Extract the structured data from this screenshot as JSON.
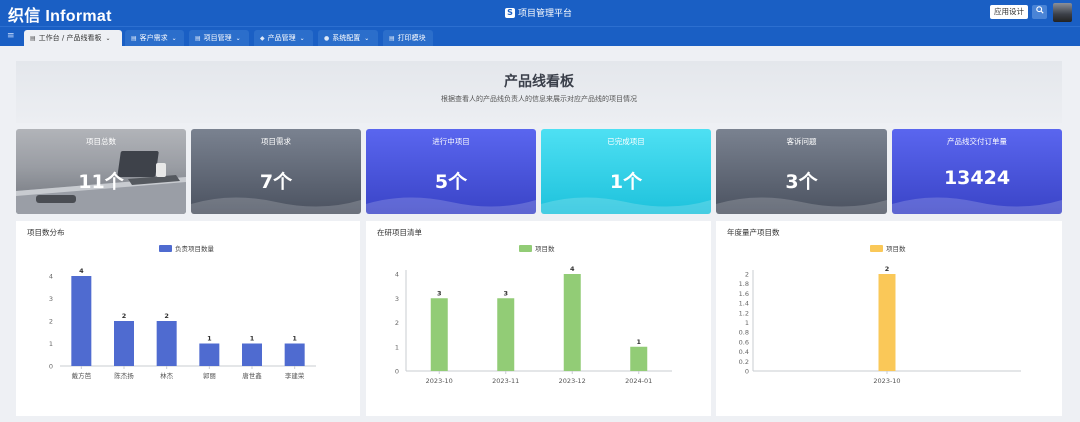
{
  "header": {
    "logo": "织信 Informat",
    "app_title": "项目管理平台",
    "app_icon_letter": "S",
    "app_design_label": "应用设计",
    "search_icon": "search-icon"
  },
  "nav": {
    "tabs": [
      {
        "label": "工作台 / 产品线看板",
        "icon": "workbench-icon",
        "active": true,
        "has_dropdown": true
      },
      {
        "label": "客户需求",
        "icon": "list-icon",
        "has_dropdown": true
      },
      {
        "label": "项目管理",
        "icon": "list-icon",
        "has_dropdown": true
      },
      {
        "label": "产品管理",
        "icon": "diamond-icon",
        "has_dropdown": true
      },
      {
        "label": "系统配置",
        "icon": "person-icon",
        "has_dropdown": true
      },
      {
        "label": "打印模块",
        "icon": "list-icon",
        "has_dropdown": false
      }
    ]
  },
  "banner": {
    "title": "产品线看板",
    "subtitle": "根据查看人的产品线负责人的信息来展示对应产品线的项目情况"
  },
  "cards": [
    {
      "label": "项目总数",
      "value": "11个",
      "style": "photo"
    },
    {
      "label": "项目需求",
      "value": "7个",
      "colors": [
        "#7a8290",
        "#4b5260"
      ]
    },
    {
      "label": "进行中项目",
      "value": "5个",
      "colors": [
        "#5a66ef",
        "#3a44c7"
      ]
    },
    {
      "label": "已完成项目",
      "value": "1个",
      "colors": [
        "#4ee0f3",
        "#1ec2dc"
      ]
    },
    {
      "label": "客诉问题",
      "value": "3个",
      "colors": [
        "#7a8290",
        "#4b5260"
      ]
    },
    {
      "label": "产品线交付订单量",
      "value": "13424",
      "colors": [
        "#5a66ef",
        "#3a44c7"
      ]
    }
  ],
  "panels": {
    "distribution": {
      "title": "项目数分布",
      "legend": "负责项目数量"
    },
    "in_progress": {
      "title": "在研项目清单",
      "legend": "项目数"
    },
    "annual": {
      "title": "年度量产项目数",
      "legend": "项目数"
    }
  },
  "chart_data": [
    {
      "type": "bar",
      "title": "项目数分布",
      "categories": [
        "戴方芭",
        "陈杰扬",
        "林杰",
        "郭丽",
        "唐世鑫",
        "李建荣"
      ],
      "series": [
        {
          "name": "负责项目数量",
          "values": [
            4,
            2,
            2,
            1,
            1,
            1
          ],
          "color": "#4f6bd0"
        }
      ],
      "ylim": [
        0,
        4
      ],
      "yticks": [
        0,
        1,
        2,
        3,
        4
      ],
      "data_labels": true,
      "legend": "top-center"
    },
    {
      "type": "bar",
      "title": "在研项目清单",
      "categories": [
        "2023-10",
        "2023-11",
        "2023-12",
        "2024-01"
      ],
      "series": [
        {
          "name": "项目数",
          "values": [
            3,
            3,
            4,
            1
          ],
          "color": "#92cc76"
        }
      ],
      "ylim": [
        0,
        4
      ],
      "yticks": [
        0,
        1,
        2,
        3,
        4
      ],
      "data_labels": true,
      "legend": "top-center"
    },
    {
      "type": "bar",
      "title": "年度量产项目数",
      "categories": [
        "2023-10"
      ],
      "series": [
        {
          "name": "项目数",
          "values": [
            2
          ],
          "color": "#fac858"
        }
      ],
      "ylim": [
        0,
        2
      ],
      "yticks": [
        0,
        0.2,
        0.4,
        0.6,
        0.8,
        1,
        1.2,
        1.4,
        1.6,
        1.8,
        2
      ],
      "data_labels": true,
      "legend": "top-center"
    }
  ]
}
